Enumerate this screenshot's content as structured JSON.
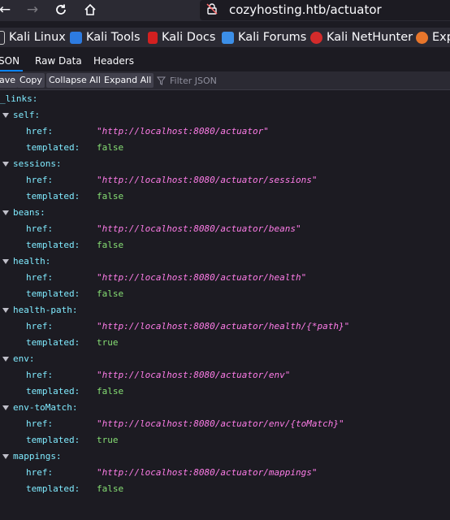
{
  "browser": {
    "url": "cozyhosting.htb/actuator",
    "bookmarks": [
      "Kali Linux",
      "Kali Tools",
      "Kali Docs",
      "Kali Forums",
      "Kali NetHunter",
      "Exp"
    ]
  },
  "viewer": {
    "tabs": [
      "SON",
      "Raw Data",
      "Headers"
    ],
    "toolbar": [
      "ave",
      "Copy",
      "Collapse All",
      "Expand All"
    ],
    "filter_placeholder": "Filter JSON"
  },
  "json": {
    "root_key": "_links:",
    "field_labels": {
      "href": "href:",
      "templated": "templated:"
    },
    "entries": [
      {
        "key": "self:",
        "href": "\"http://localhost:8080/actuator\"",
        "templated": "false"
      },
      {
        "key": "sessions:",
        "href": "\"http://localhost:8080/actuator/sessions\"",
        "templated": "false"
      },
      {
        "key": "beans:",
        "href": "\"http://localhost:8080/actuator/beans\"",
        "templated": "false"
      },
      {
        "key": "health:",
        "href": "\"http://localhost:8080/actuator/health\"",
        "templated": "false"
      },
      {
        "key": "health-path:",
        "href": "\"http://localhost:8080/actuator/health/{*path}\"",
        "templated": "true"
      },
      {
        "key": "env:",
        "href": "\"http://localhost:8080/actuator/env\"",
        "templated": "false"
      },
      {
        "key": "env-toMatch:",
        "href": "\"http://localhost:8080/actuator/env/{toMatch}\"",
        "templated": "true"
      },
      {
        "key": "mappings:",
        "href": "\"http://localhost:8080/actuator/mappings\"",
        "templated": "false"
      }
    ]
  }
}
